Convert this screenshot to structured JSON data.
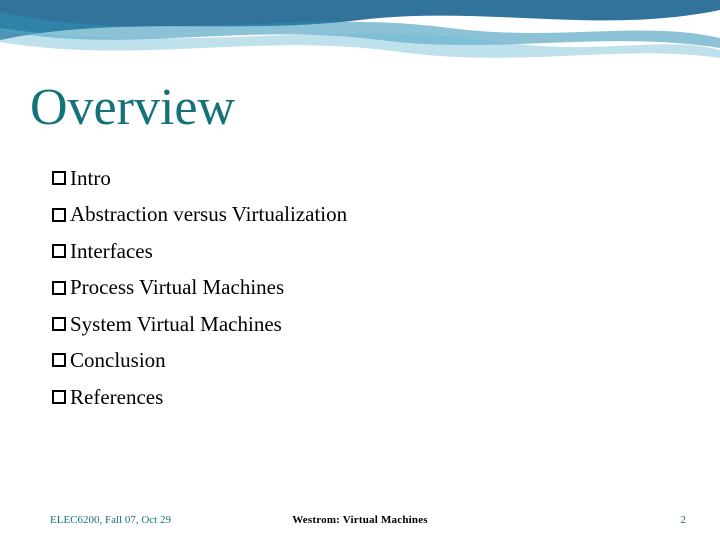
{
  "slide": {
    "title": "Overview",
    "bullets": [
      "Intro",
      "Abstraction versus Virtualization",
      "Interfaces",
      "Process Virtual Machines",
      "System Virtual Machines",
      "Conclusion",
      "References"
    ]
  },
  "footer": {
    "left": "ELEC6200, Fall 07, Oct 29",
    "center": "Westrom: Virtual Machines",
    "page": "2"
  },
  "colors": {
    "accent": "#14727a",
    "banner_dark": "#0e5a8a",
    "banner_light": "#4aa0c4"
  }
}
